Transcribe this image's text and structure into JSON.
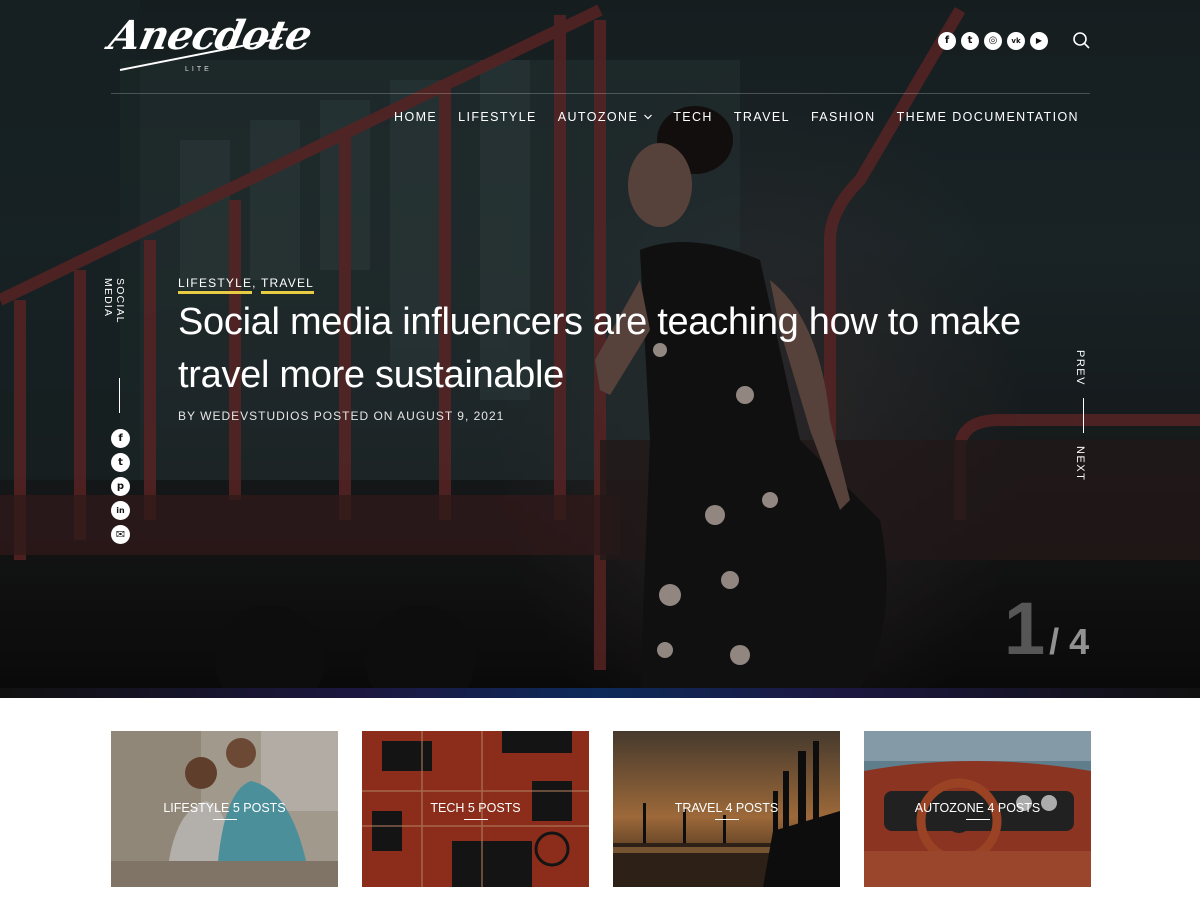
{
  "header": {
    "logo_text": "Anecdote",
    "logo_sub": "LITE",
    "social": [
      {
        "icon": "facebook-icon",
        "glyph": "f"
      },
      {
        "icon": "twitter-icon",
        "glyph": "t"
      },
      {
        "icon": "instagram-icon",
        "glyph": "◎"
      },
      {
        "icon": "vk-icon",
        "glyph": "vk"
      },
      {
        "icon": "youtube-icon",
        "glyph": "▶"
      }
    ],
    "search_icon": "search-icon"
  },
  "nav": {
    "items": [
      "HOME",
      "LIFESTYLE",
      "AUTOZONE",
      "TECH",
      "TRAVEL",
      "FASHION",
      "THEME DOCUMENTATION"
    ]
  },
  "rail": {
    "label": "SOCIAL MEDIA",
    "icons": [
      {
        "icon": "facebook-icon",
        "glyph": "f"
      },
      {
        "icon": "twitter-icon",
        "glyph": "t"
      },
      {
        "icon": "pinterest-icon",
        "glyph": "p"
      },
      {
        "icon": "linkedin-icon",
        "glyph": "in"
      },
      {
        "icon": "mail-icon",
        "glyph": "✉"
      }
    ]
  },
  "post": {
    "cat1": "LIFESTYLE",
    "cat_sep": ", ",
    "cat2": "TRAVEL",
    "title": "Social media influencers are teaching how to make travel more sustainable",
    "meta": "BY WEDEVSTUDIOS POSTED ON AUGUST 9, 2021"
  },
  "slider": {
    "prev": "PREV",
    "next": "NEXT",
    "current": "1",
    "total": "/ 4"
  },
  "categories": [
    {
      "label": "LIFESTYLE 5 POSTS"
    },
    {
      "label": "TECH 5 POSTS"
    },
    {
      "label": "TRAVEL 4 POSTS"
    },
    {
      "label": "AUTOZONE 4 POSTS"
    }
  ],
  "colors": {
    "accent_underline": "#e8cc44",
    "hero_dark": "#1c2224"
  }
}
